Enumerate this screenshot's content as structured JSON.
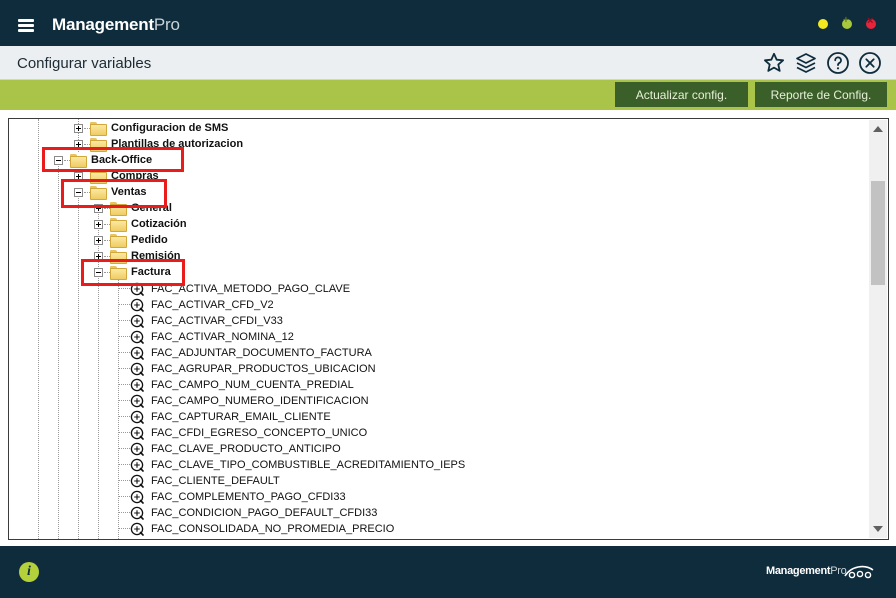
{
  "app": {
    "brand_bold": "Management",
    "brand_light": "Pro"
  },
  "header": {
    "title": "Configurar variables"
  },
  "actions": {
    "update_label": "Actualizar config.",
    "report_label": "Reporte de Config."
  },
  "tree": {
    "nodes": {
      "sms": "Configuracion de SMS",
      "plantillas": "Plantillas de autorizacion",
      "backoffice": "Back-Office",
      "compras": "Compras",
      "ventas": "Ventas",
      "general": "General",
      "cotizacion": "Cotización",
      "pedido": "Pedido",
      "remision": "Remisión",
      "factura": "Factura"
    },
    "variables": [
      "FAC_ACTIVA_METODO_PAGO_CLAVE",
      "FAC_ACTIVAR_CFD_V2",
      "FAC_ACTIVAR_CFDI_V33",
      "FAC_ACTIVAR_NOMINA_12",
      "FAC_ADJUNTAR_DOCUMENTO_FACTURA",
      "FAC_AGRUPAR_PRODUCTOS_UBICACION",
      "FAC_CAMPO_NUM_CUENTA_PREDIAL",
      "FAC_CAMPO_NUMERO_IDENTIFICACION",
      "FAC_CAPTURAR_EMAIL_CLIENTE",
      "FAC_CFDI_EGRESO_CONCEPTO_UNICO",
      "FAC_CLAVE_PRODUCTO_ANTICIPO",
      "FAC_CLAVE_TIPO_COMBUSTIBLE_ACREDITAMIENTO_IEPS",
      "FAC_CLIENTE_DEFAULT",
      "FAC_COMPLEMENTO_PAGO_CFDI33",
      "FAC_CONDICION_PAGO_DEFAULT_CFDI33",
      "FAC_CONSOLIDADA_NO_PROMEDIA_PRECIO"
    ]
  },
  "footer": {
    "logo_bold": "Management",
    "logo_light": "Pro",
    "info_glyph": "i"
  },
  "colors": {
    "titlebar": "#0f2c3c",
    "actionbar": "#aac44a",
    "button": "#3b5f28",
    "highlight": "#ea1b1b"
  },
  "icons": [
    "menu-icon",
    "star-icon",
    "layers-icon",
    "help-icon",
    "close-circle-icon",
    "folder-icon",
    "variable-icon",
    "info-icon"
  ]
}
